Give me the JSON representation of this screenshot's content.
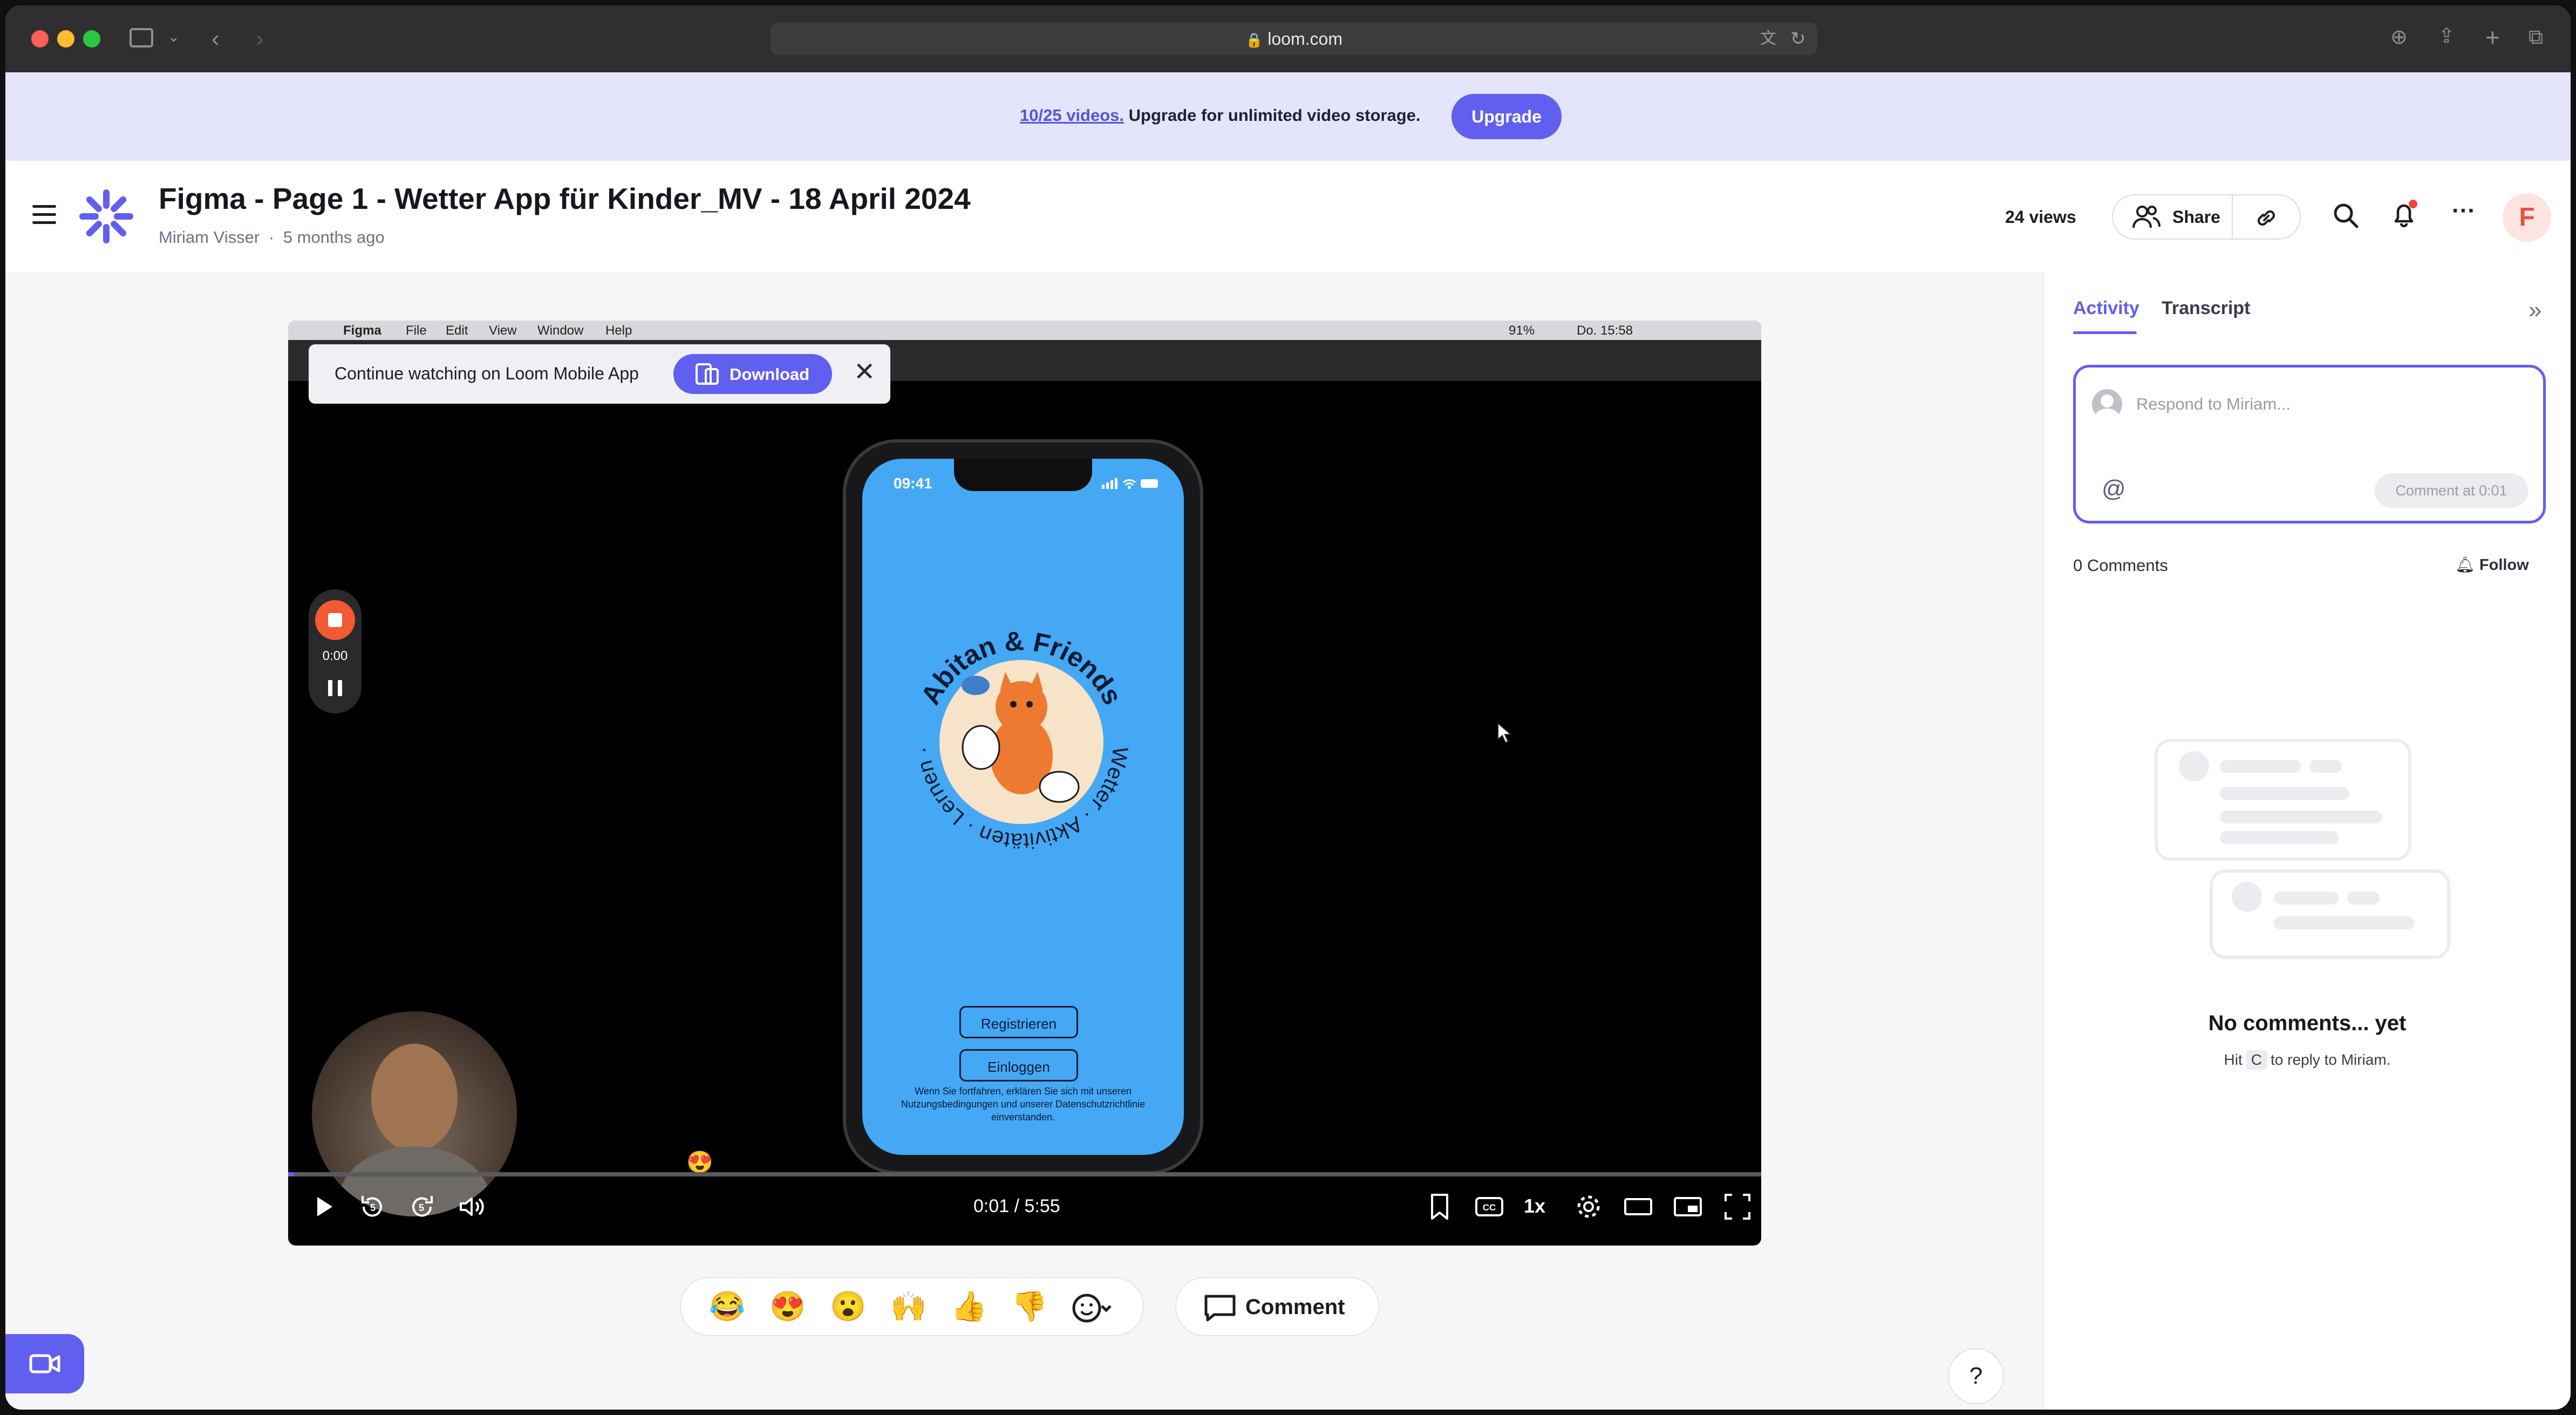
{
  "browser": {
    "url": "loom.com"
  },
  "banner": {
    "usage_link": "10/25 videos.",
    "message": " Upgrade for unlimited video storage.",
    "upgrade_label": "Upgrade"
  },
  "header": {
    "title": "Figma - Page 1 - Wetter App für Kinder_MV - 18 April 2024",
    "author": "Miriam Visser",
    "separator": "·",
    "age": "5 months ago",
    "views": "24 views",
    "share_label": "Share",
    "avatar_letter": "F"
  },
  "video": {
    "mac_menu": [
      "Figma",
      "File",
      "Edit",
      "View",
      "Window",
      "Help"
    ],
    "mac_clock": "Do. 15:58",
    "mac_battery": "91%",
    "continue_text": "Continue watching on Loom Mobile App",
    "download_label": "Download",
    "recorder_time": "0:00",
    "phone": {
      "time": "09:41",
      "badge_top": "Abitan & Friends",
      "badge_side": "Wetter · Aktivitäten · Lernen ·",
      "register_label": "Registrieren",
      "login_label": "Einloggen",
      "legal": "Wenn Sie fortfahren, erklären Sie sich mit unseren Nutzungsbedingungen und unserer Datenschutzrichtlinie einverstanden."
    },
    "time_readout": "0:01 / 5:55",
    "progress": 0.003,
    "speed_label": "1x",
    "rewind_seconds": "5",
    "forward_seconds": "5"
  },
  "reactions": [
    "😂",
    "😍",
    "😮",
    "🙌",
    "👍",
    "👎"
  ],
  "comment_button_label": "Comment",
  "help_label": "?",
  "sidebar": {
    "tab_activity": "Activity",
    "tab_transcript": "Transcript",
    "comment_placeholder": "Respond to Miriam...",
    "mention_symbol": "@",
    "comment_submit": "Comment at 0:01",
    "comments_count": "0 Comments",
    "follow_label": "Follow",
    "empty_title": "No comments... yet",
    "empty_hint_prefix": "Hit",
    "empty_hint_key": "C",
    "empty_hint_suffix": "to reply to Miriam."
  },
  "colors": {
    "accent": "#615ff0",
    "banner_bg": "#e4e5fb",
    "phone_screen": "#44a8f4",
    "record_button": "#f15a32"
  },
  "icons": [
    "menu-icon",
    "loom-logo-icon",
    "share-people-icon",
    "link-icon",
    "search-icon",
    "bell-icon",
    "more-icon",
    "play-icon",
    "rewind-icon",
    "forward-icon",
    "volume-icon",
    "bookmark-icon",
    "captions-icon",
    "settings-icon",
    "theater-icon",
    "pip-icon",
    "fullscreen-icon",
    "add-reaction-icon",
    "comment-icon",
    "record-camera-icon",
    "collapse-icon",
    "follow-bell-icon"
  ]
}
